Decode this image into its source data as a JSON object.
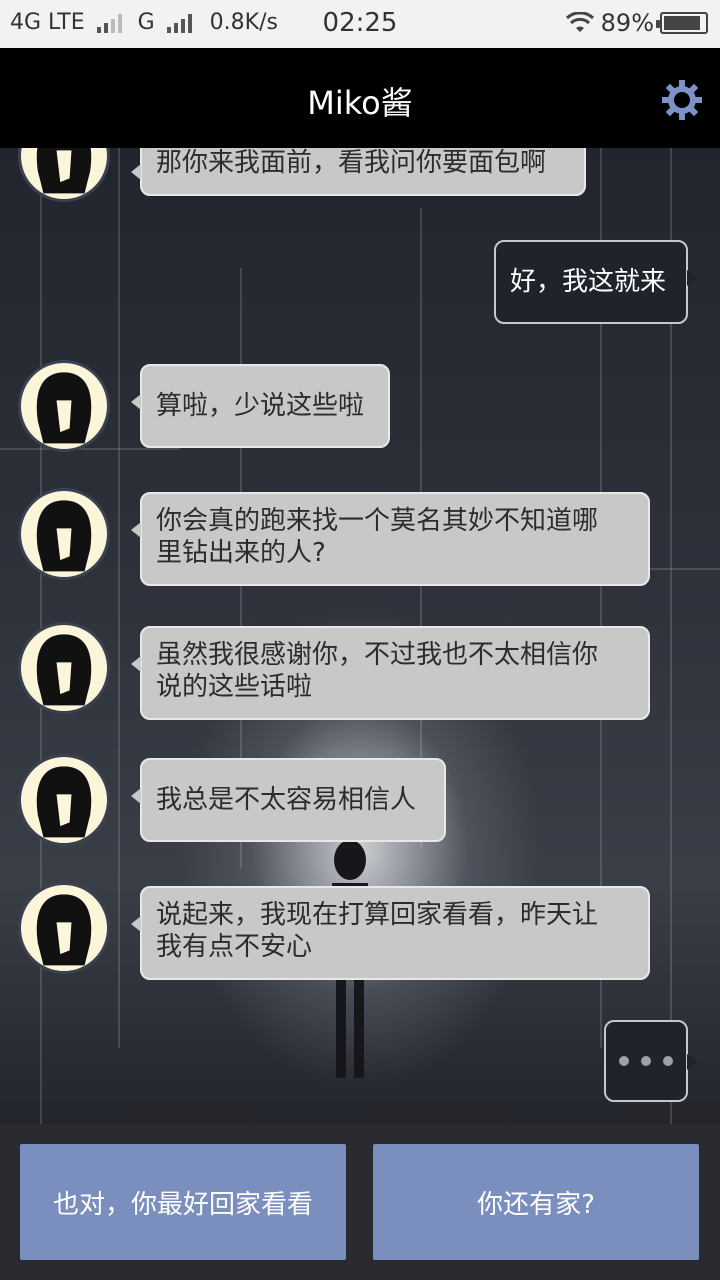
{
  "status_bar": {
    "network1": "4G LTE",
    "network2": "G",
    "speed": "0.8K/s",
    "time": "02:25",
    "battery": "89%",
    "battery_level": 0.89
  },
  "header": {
    "title": "Miko酱",
    "settings_icon": "gear-icon",
    "icon_color": "#7d93c7"
  },
  "messages": [
    {
      "from": "miko",
      "text": "那你来我面前，看我问你要面包啊"
    },
    {
      "from": "me",
      "text": "好，我这就来"
    },
    {
      "from": "miko",
      "text": "算啦，少说这些啦"
    },
    {
      "from": "miko",
      "line1": "你会真的跑来找一个莫名其妙不知道哪",
      "line2": "里钻出来的人?"
    },
    {
      "from": "miko",
      "line1": "虽然我很感谢你，不过我也不太相信你",
      "line2": "说的这些话啦"
    },
    {
      "from": "miko",
      "text": "我总是不太容易相信人"
    },
    {
      "from": "miko",
      "line1": "说起来，我现在打算回家看看，昨天让",
      "line2": "我有点不安心"
    }
  ],
  "typing_indicator": "ellipsis-icon",
  "choices": [
    {
      "label": "也对，你最好回家看看"
    },
    {
      "label": "你还有家?"
    }
  ],
  "colors": {
    "choice_button": "#7a8fbd",
    "miko_bubble": "#c8c8c8",
    "my_bubble": "#1f232c"
  }
}
